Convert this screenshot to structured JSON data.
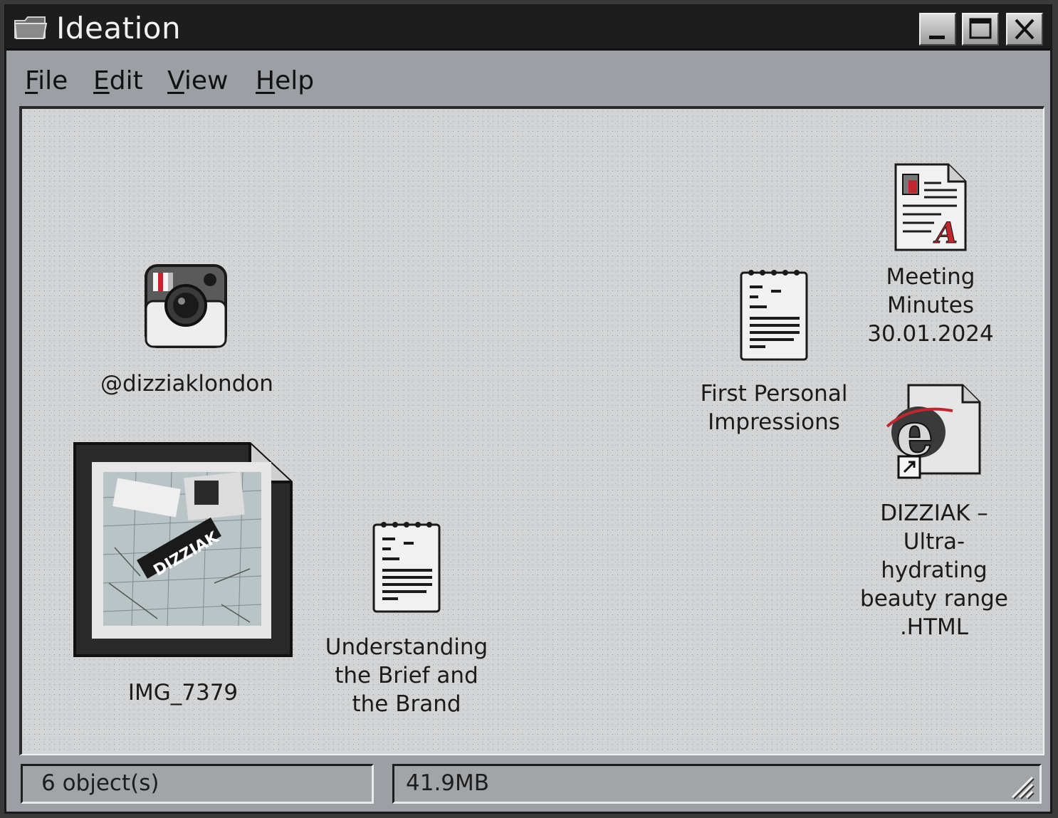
{
  "window": {
    "title": "Ideation",
    "buttons": {
      "minimize": "minimize",
      "maximize": "maximize",
      "close": "close"
    }
  },
  "menu": {
    "items": [
      {
        "first": "F",
        "rest": "ile"
      },
      {
        "first": "E",
        "rest": "dit"
      },
      {
        "first": "V",
        "rest": "iew"
      },
      {
        "first": "H",
        "rest": "elp"
      }
    ]
  },
  "desktop": {
    "icons": [
      {
        "label": "@dizziaklondon",
        "icon": "instagram-camera-icon"
      },
      {
        "label": "IMG_7379",
        "icon": "image-photo-icon"
      },
      {
        "label": "Understanding\nthe Brief and\nthe Brand",
        "icon": "notepad-icon"
      },
      {
        "label": "First Personal\nImpressions",
        "icon": "notepad-icon"
      },
      {
        "label": "Meeting\nMinutes\n30.01.2024",
        "icon": "document-icon"
      },
      {
        "label": "DIZZIAK –\nUltra-\nhydrating\nbeauty range\n.HTML",
        "icon": "internet-explorer-shortcut-icon"
      }
    ]
  },
  "statusbar": {
    "objects": "6 object(s)",
    "size": "41.9MB"
  },
  "colors": {
    "titlebar": "#1d1d1e",
    "window": "#9c9fa3",
    "content": "#d2d4d5",
    "accent_red": "#c0282d"
  }
}
